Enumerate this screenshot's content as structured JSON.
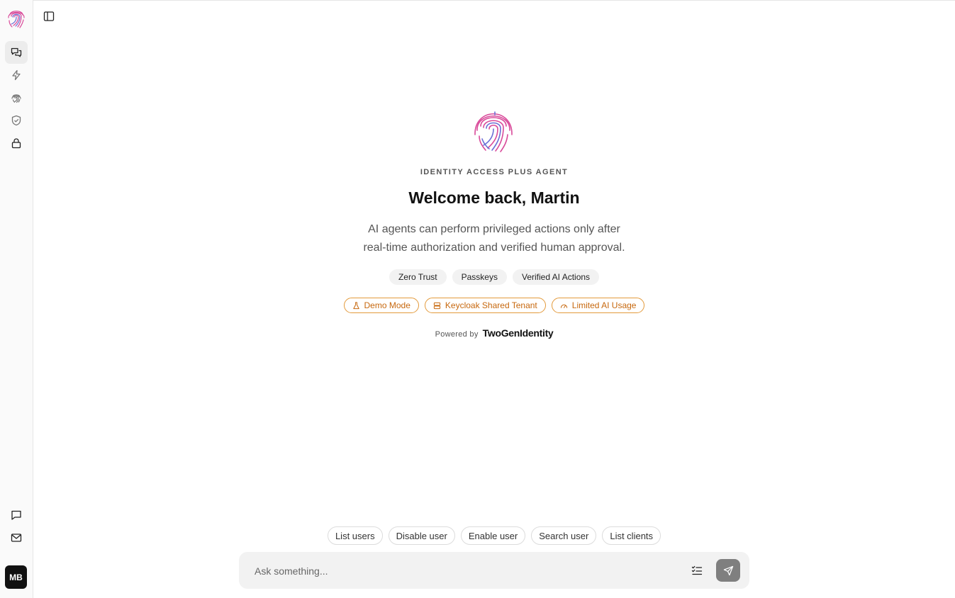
{
  "rail": {
    "items": [
      {
        "name": "conversations"
      },
      {
        "name": "automations"
      },
      {
        "name": "identity"
      },
      {
        "name": "security"
      },
      {
        "name": "access"
      }
    ],
    "bottom": [
      {
        "name": "feedback"
      },
      {
        "name": "mail"
      }
    ],
    "avatar_initials": "MB"
  },
  "hero": {
    "eyebrow": "IDENTITY ACCESS PLUS AGENT",
    "title": "Welcome back, Martin",
    "subtitle_line1": "AI agents can perform privileged actions only after",
    "subtitle_line2": "real-time authorization and verified human approval.",
    "pills": [
      "Zero Trust",
      "Passkeys",
      "Verified AI Actions"
    ],
    "badges": [
      {
        "label": "Demo Mode",
        "icon": "flask-icon"
      },
      {
        "label": "Keycloak Shared Tenant",
        "icon": "server-icon"
      },
      {
        "label": "Limited AI Usage",
        "icon": "gauge-icon"
      }
    ],
    "powered_by": "Powered by",
    "brand": "TwoGenIdentity"
  },
  "suggestions": [
    "List users",
    "Disable user",
    "Enable user",
    "Search user",
    "List clients"
  ],
  "composer": {
    "placeholder": "Ask something..."
  },
  "colors": {
    "accent_orange": "#e39a3b",
    "logo_pink": "#d94a9a",
    "logo_blue": "#6a6fd6"
  }
}
